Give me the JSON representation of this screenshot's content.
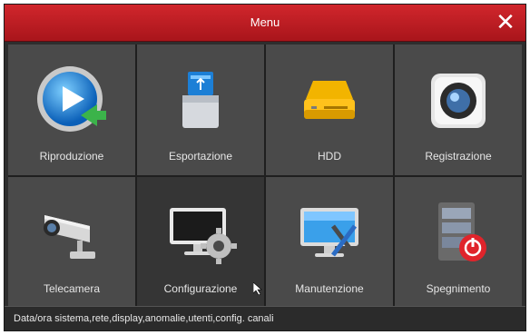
{
  "window": {
    "title": "Menu"
  },
  "close_icon": "close-icon",
  "tiles": [
    {
      "label": "Riproduzione",
      "icon": "playback-icon"
    },
    {
      "label": "Esportazione",
      "icon": "usb-drive-icon"
    },
    {
      "label": "HDD",
      "icon": "hard-disk-icon"
    },
    {
      "label": "Registrazione",
      "icon": "record-camera-icon"
    },
    {
      "label": "Telecamera",
      "icon": "cctv-camera-icon"
    },
    {
      "label": "Configurazione",
      "icon": "settings-monitor-icon",
      "selected": true
    },
    {
      "label": "Manutenzione",
      "icon": "maintenance-monitor-icon"
    },
    {
      "label": "Spegnimento",
      "icon": "power-server-icon"
    }
  ],
  "status": {
    "text": "Data/ora sistema,rete,display,anomalie,utenti,config. canali"
  },
  "colors": {
    "title_bar": "#c21d23",
    "tile": "#4a4a4a",
    "tile_selected": "#353535"
  }
}
